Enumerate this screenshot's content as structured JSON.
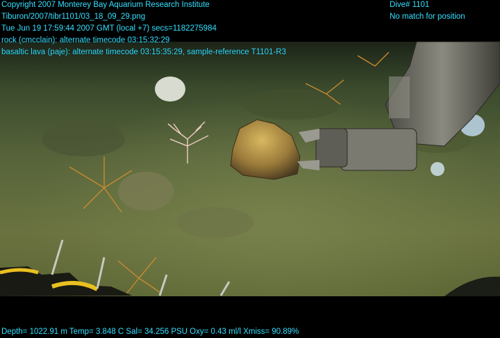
{
  "overlay": {
    "header_lines": [
      "Copyright 2007 Monterey Bay Aquarium Research Institute",
      "Tiburon/2007/tibr1101/03_18_09_29.png",
      "Tue Jun 19 17:59:44 2007 GMT (local +7)  secs=1182275984",
      "rock (cmcclain): alternate timecode 03:15:32:29",
      "basaltic lava (paje): alternate timecode 03:15:35:29, sample-reference T1101-R3"
    ],
    "dive_lines": [
      "Dive# 1101",
      "No match for position"
    ],
    "footer": "Depth= 1022.91 m  Temp= 3.848 C  Sal= 34.256 PSU  Oxy= 0.43 ml/l  Xmiss= 90.89%"
  },
  "colors": {
    "overlay_text": "#33e0ff",
    "seafloor": "#5a6a3a",
    "water": "#2e3a24",
    "arm": "#6b6a62"
  }
}
